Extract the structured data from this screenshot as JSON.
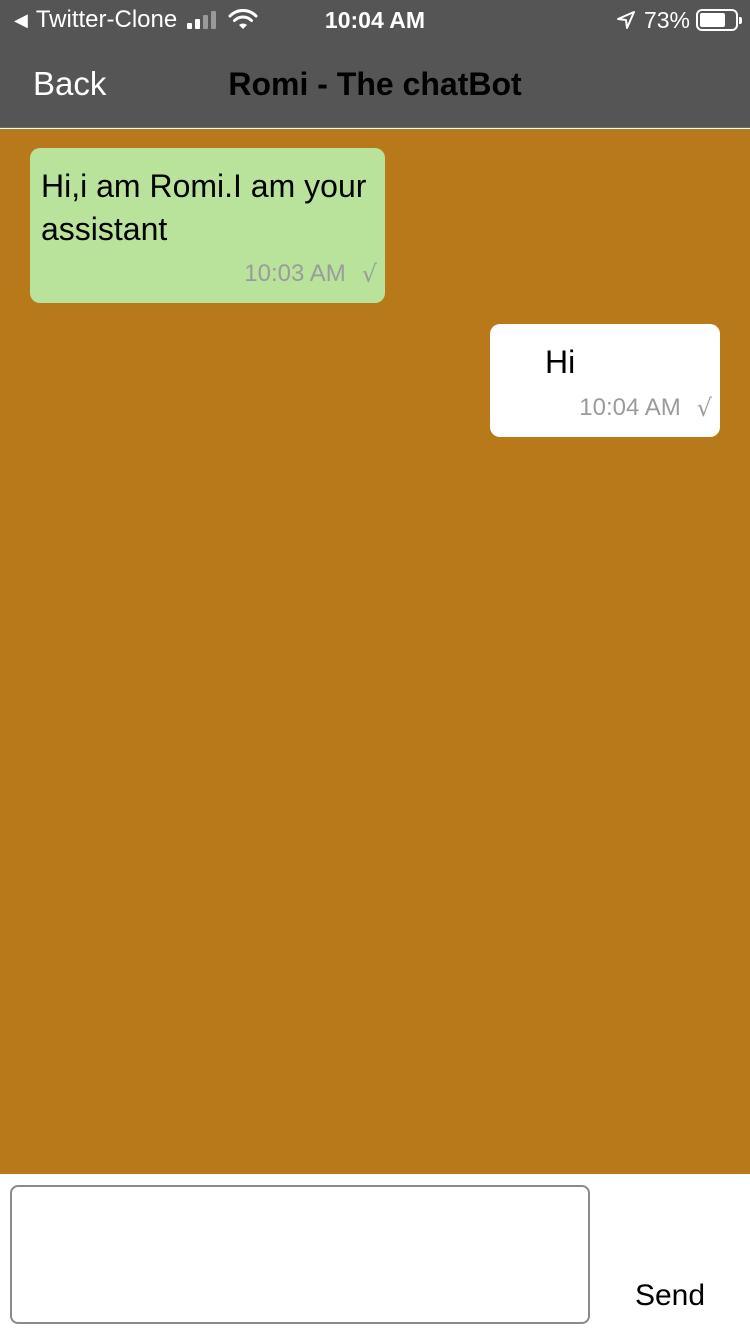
{
  "status_bar": {
    "back_app": "Twitter-Clone",
    "time": "10:04 AM",
    "battery": "73%",
    "battery_level": 0.73,
    "signal_bars_active": 2,
    "signal_bars_total": 4,
    "icons": [
      "back-triangle-icon",
      "signal-icon",
      "wifi-icon",
      "location-arrow-icon",
      "battery-icon"
    ]
  },
  "nav": {
    "back_label": "Back",
    "title": "Romi - The chatBot"
  },
  "colors": {
    "bars": "#555555",
    "chat_background": "#b8791b",
    "bot_bubble": "#b9e39a",
    "user_bubble": "#ffffff",
    "meta_text": "#9b9b9b"
  },
  "messages": [
    {
      "sender": "bot",
      "text": "Hi,i am Romi.I am your assistant",
      "time": "10:03 AM",
      "check": "√"
    },
    {
      "sender": "user",
      "text": "Hi",
      "time": "10:04 AM",
      "check": "√"
    }
  ],
  "composer": {
    "value": "",
    "send_label": "Send"
  }
}
